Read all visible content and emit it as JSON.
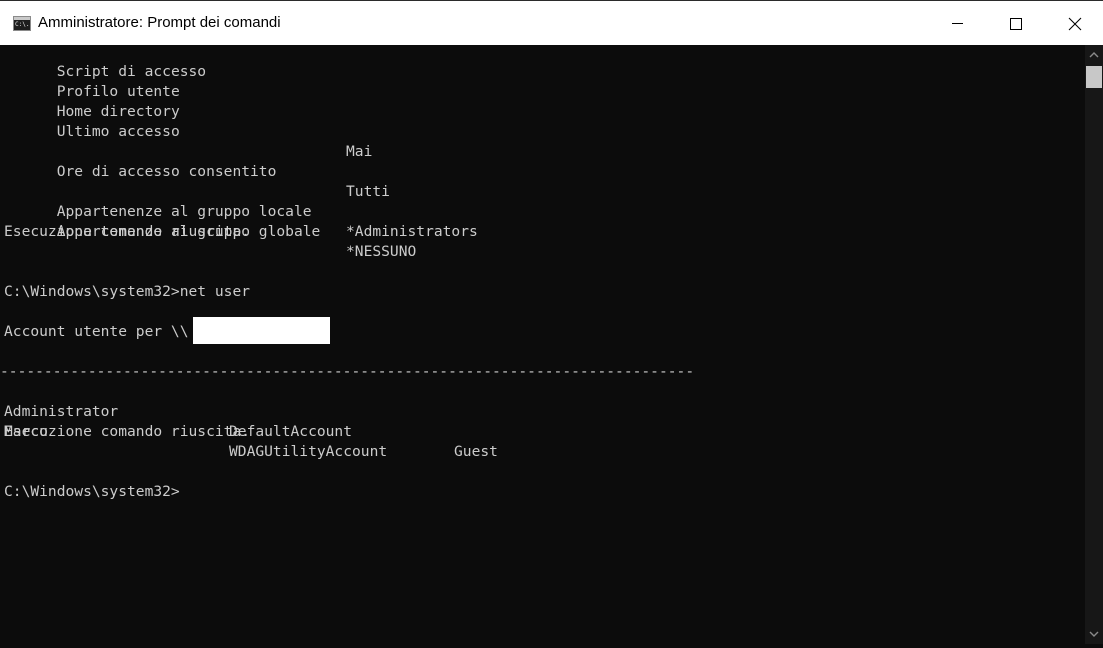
{
  "window": {
    "title": "Amministratore: Prompt dei comandi",
    "icon": "cmd-icon",
    "icon_text": "C:\\.",
    "controls": {
      "minimize": "minimize-icon",
      "maximize": "maximize-icon",
      "close": "close-icon"
    }
  },
  "console": {
    "user_info": [
      {
        "label": "Script di accesso",
        "value": ""
      },
      {
        "label": "Profilo utente",
        "value": ""
      },
      {
        "label": "Home directory",
        "value": ""
      },
      {
        "label": "Ultimo accesso",
        "value": "Mai"
      },
      {
        "label": "Ore di accesso consentito",
        "value": "Tutti"
      },
      {
        "label": "Appartenenze al gruppo locale",
        "value": "*Administrators"
      },
      {
        "label": "Appartenenze al gruppo globale",
        "value": "*NESSUNO"
      }
    ],
    "success_1": "Esecuzione comando riuscita.",
    "command_line": "C:\\Windows\\system32>net user",
    "accounts_header": "Account utente per \\\\",
    "separator": "-------------------------------------------------------------------------------",
    "accounts": [
      [
        "Administrator",
        "DefaultAccount",
        "Guest"
      ],
      [
        "Marco",
        "WDAGUtilityAccount",
        ""
      ]
    ],
    "success_2": "Esecuzione comando riuscita.",
    "prompt": "C:\\Windows\\system32>"
  },
  "colors": {
    "console_bg": "#0c0c0c",
    "console_text": "#cccccc",
    "titlebar_bg": "#ffffff"
  }
}
